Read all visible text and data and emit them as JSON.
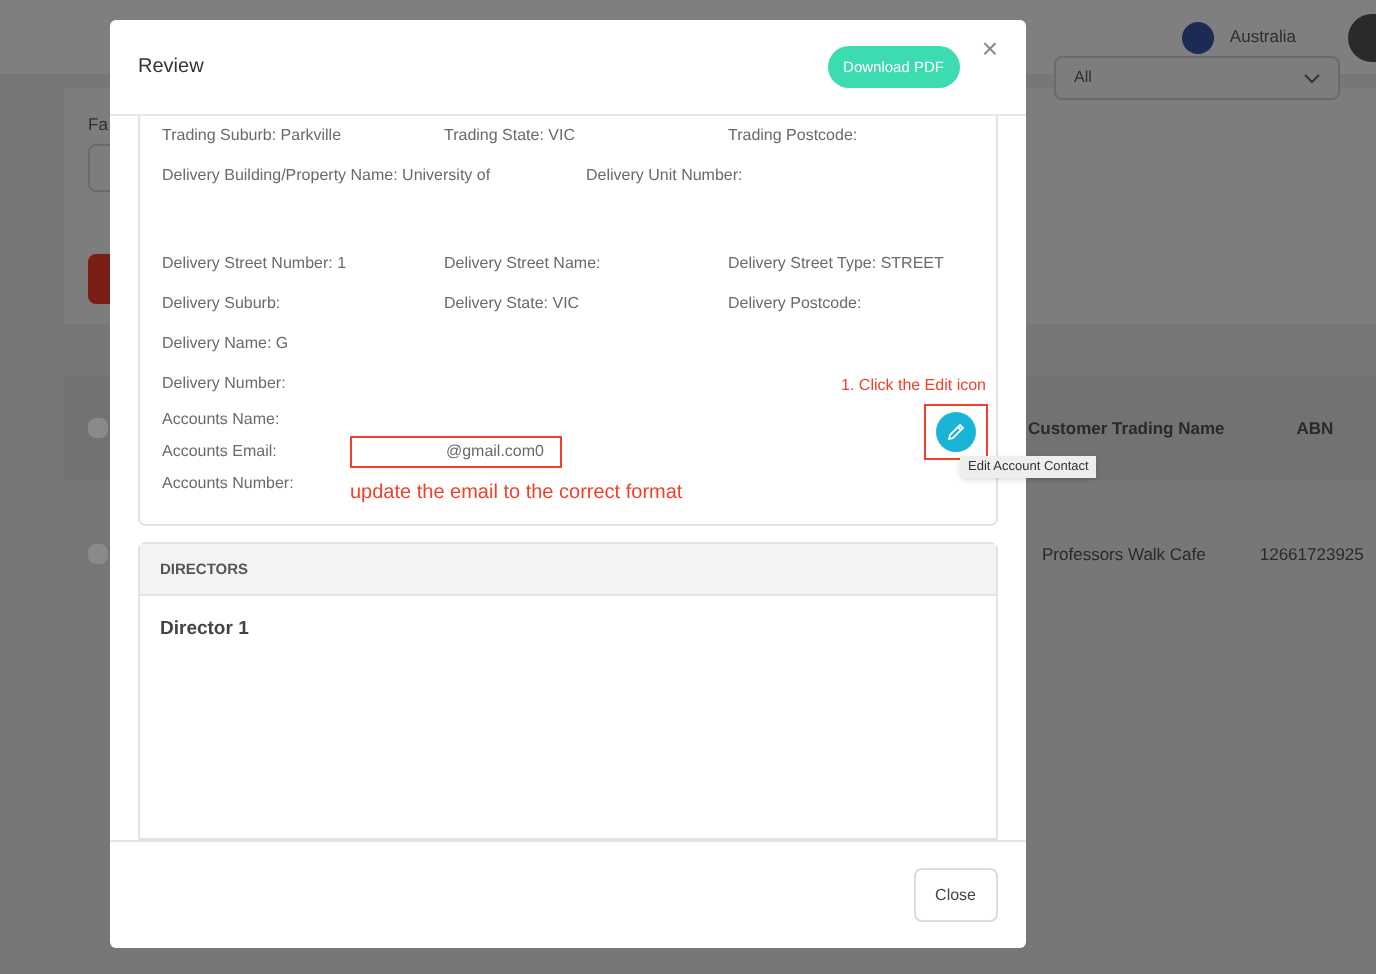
{
  "backdrop": {
    "country": "Australia",
    "filter_label": "Fa",
    "filter_value": "All",
    "table": {
      "all_checked": false,
      "columns": [
        "Customer Trading Name",
        "ABN"
      ],
      "rows": [
        {
          "checked": false,
          "cells": [
            "Professors Walk Cafe",
            "12661723925"
          ]
        }
      ]
    }
  },
  "modal": {
    "title": "Review",
    "download_button": "Download PDF",
    "close_icon": "×",
    "detail_groups": [
      [
        {
          "kind": "three",
          "cells": [
            "Trading Suburb: Parkville",
            "Trading State: VIC",
            "Trading Postcode:"
          ]
        },
        {
          "kind": "two",
          "cells": [
            "Delivery Building/Property Name: University of",
            "Delivery Unit Number:"
          ]
        }
      ],
      [
        {
          "kind": "three",
          "cells": [
            "Delivery Street Number: 1",
            "Delivery Street Name:",
            "Delivery Street Type: STREET"
          ]
        },
        {
          "kind": "three",
          "cells": [
            "Delivery Suburb:",
            "Delivery State: VIC",
            "Delivery Postcode:"
          ]
        },
        {
          "kind": "three",
          "cells": [
            "Delivery Name: G"
          ]
        },
        {
          "kind": "three",
          "cells": [
            "Delivery Number:"
          ]
        }
      ]
    ],
    "edit_note": "1. Click the Edit icon",
    "accounts": [
      {
        "label": "Accounts Name:"
      },
      {
        "label": "Accounts Email:",
        "value": "@gmail.com0"
      },
      {
        "label": "Accounts Number:"
      }
    ],
    "email_note": "update the email to the correct format",
    "edit_tooltip": "Edit Account Contact",
    "directors": {
      "heading": "DIRECTORS",
      "items": [
        "Director 1"
      ]
    },
    "close_button": "Close"
  }
}
